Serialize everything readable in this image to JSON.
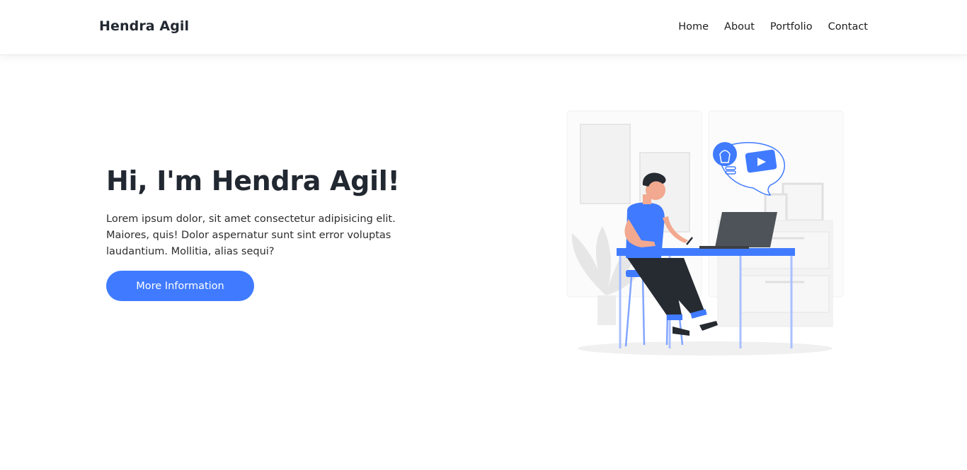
{
  "nav": {
    "brand": "Hendra Agil",
    "links": [
      "Home",
      "About",
      "Portfolio",
      "Contact"
    ]
  },
  "hero": {
    "title": "Hi, I'm Hendra Agil!",
    "text": "Lorem ipsum dolor, sit amet consectetur adipisicing elit. Maiores, quis! Dolor aspernatur sunt sint error voluptas laudantium. Mollitia, alias sequi?",
    "button_label": "More Information"
  },
  "colors": {
    "accent": "#407bff",
    "heading": "#222831"
  },
  "icons": {
    "illustration": "person-working-at-laptop-illustration",
    "bulb": "lightbulb-icon",
    "video": "video-play-icon"
  }
}
